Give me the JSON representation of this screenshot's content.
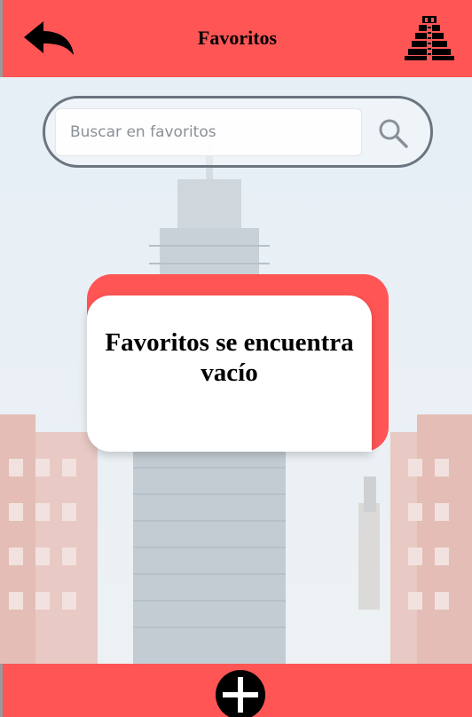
{
  "header": {
    "title": "Favoritos",
    "back_icon": "back-arrow-icon",
    "logo_icon": "pyramid-icon"
  },
  "search": {
    "placeholder": "Buscar en favoritos",
    "value": "",
    "icon": "search-icon"
  },
  "empty_state": {
    "message": "Favoritos se encuentra vacío"
  },
  "footer": {
    "add_icon": "add-icon"
  },
  "colors": {
    "accent": "#ff5555",
    "card": "#ffffff",
    "search_border": "#6b7580"
  }
}
